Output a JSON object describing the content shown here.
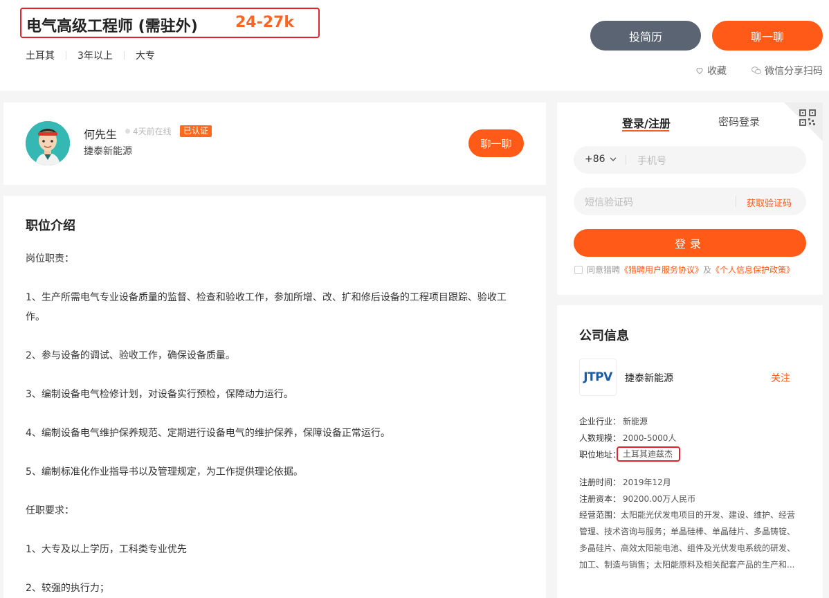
{
  "header": {
    "job_title": "电气高级工程师 (需驻外)",
    "salary": "24-27k",
    "tags": [
      "土耳其",
      "3年以上",
      "大专"
    ],
    "resume_button": "投简历",
    "chat_button": "聊一聊",
    "favorite_label": "收藏",
    "share_label": "微信分享扫码"
  },
  "recruiter": {
    "name": "何先生",
    "online_status": "4天前在线",
    "verified_badge": "已认证",
    "company": "捷泰新能源",
    "chat_button": "聊一聊"
  },
  "description": {
    "title": "职位介绍",
    "lines": [
      "岗位职责：",
      "",
      "1、生产所需电气专业设备质量的监督、检查和验收工作，参加所增、改、扩和修后设备的工程项目跟踪、验收工作。",
      "",
      "2、参与设备的调试、验收工作，确保设备质量。",
      "",
      "3、编制设备电气检修计划，对设备实行预检，保障动力运行。",
      "",
      "4、编制设备电气维护保养规范、定期进行设备电气的维护保养，保障设备正常运行。",
      "",
      "5、编制标准化作业指导书以及管理规定，为工作提供理论依据。",
      "",
      "任职要求：",
      "",
      "1、大专及以上学历，工科类专业优先",
      "",
      "2、较强的执行力；"
    ]
  },
  "login": {
    "tab_register": "登录/注册",
    "tab_password": "密码登录",
    "country_code": "+86",
    "phone_placeholder": "手机号",
    "code_placeholder": "短信验证码",
    "get_code": "获取验证码",
    "login_button": "登录",
    "agree_prefix": "同意猎聘",
    "agree_link1": "《猎聘用户服务协议》",
    "agree_and": "及",
    "agree_link2": "《个人信息保护政策》"
  },
  "company": {
    "title": "公司信息",
    "logo_text": "JTPV",
    "name": "捷泰新能源",
    "follow": "关注",
    "industry_label": "企业行业：",
    "industry": "新能源",
    "size_label": "人数规模：",
    "size": "2000-5000人",
    "address_label": "职位地址：",
    "address": "土耳其迪兹杰",
    "reg_time_label": "注册时间：",
    "reg_time": "2019年12月",
    "capital_label": "注册资本：",
    "capital": "90200.00万人民币",
    "scope_label": "经营范围：",
    "scope": "太阳能光伏发电项目的开发、建设、维护、经营管理、技术咨询与服务；单晶硅棒、单晶硅片、多晶铸锭、多晶硅片、高效太阳能电池、组件及光伏发电系统的研发、加工、制造与销售；太阳能原料及相关配套产品的生产和..."
  },
  "colors": {
    "accent": "#ff5a17",
    "highlight_box": "#e0242b",
    "resume_button": "#5a6473"
  }
}
